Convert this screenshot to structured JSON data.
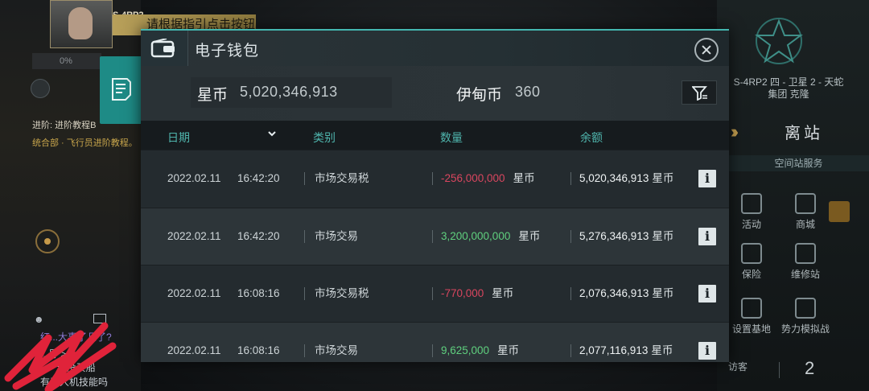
{
  "background": {
    "character_code": "S-4RP2",
    "guide_tip": "请根据指引点击按钮",
    "left_status_value": "0%",
    "progress_text": "进阶: 进阶教程B",
    "mission_text": "统合部 · 飞行员进阶教程。",
    "chat": {
      "lines": [
        "红...大事了几了?",
        "...号 > 7",
        "... - 还没买船",
        "有无人机技能吗"
      ]
    },
    "station": {
      "name_line1": "S-4RP2 四 - 卫星 2 - 天蛇",
      "name_line2": "集团 克隆",
      "undock_label": "离站",
      "services_title": "空间站服务",
      "services": [
        {
          "label": "活动",
          "icon": "party-popper-icon"
        },
        {
          "label": "商城",
          "icon": "shop-icon"
        },
        {
          "label": "保险",
          "icon": "shield-icon"
        },
        {
          "label": "维修站",
          "icon": "wrench-icon"
        },
        {
          "label": "设置基地",
          "icon": "base-icon"
        },
        {
          "label": "势力模拟战",
          "icon": "crossed-flags-icon"
        }
      ],
      "visitors_label": "访客",
      "visitors_count": "2"
    }
  },
  "wallet": {
    "title": "电子钱包",
    "icon": "wallet-icon",
    "balances": {
      "star_label": "星币",
      "star_value": "5,020,346,913",
      "yd_label": "伊甸币",
      "yd_value": "360"
    },
    "columns": {
      "date": "日期",
      "type": "类别",
      "amount": "数量",
      "balance": "余额"
    },
    "unit": "星币",
    "transactions": [
      {
        "date": "2022.02.11",
        "time": "16:42:20",
        "type": "市场交易税",
        "amount": "-256,000,000",
        "direction": "negative",
        "balance": "5,020,346,913"
      },
      {
        "date": "2022.02.11",
        "time": "16:42:20",
        "type": "市场交易",
        "amount": "3,200,000,000",
        "direction": "positive",
        "balance": "5,276,346,913"
      },
      {
        "date": "2022.02.11",
        "time": "16:08:16",
        "type": "市场交易税",
        "amount": "-770,000",
        "direction": "negative",
        "balance": "2,076,346,913"
      },
      {
        "date": "2022.02.11",
        "time": "16:08:16",
        "type": "市场交易",
        "amount": "9,625,000",
        "direction": "positive",
        "balance": "2,077,116,913"
      }
    ],
    "colors": {
      "accent": "#44b7b0",
      "negative": "#d9465f",
      "positive": "#5fd07e"
    }
  }
}
